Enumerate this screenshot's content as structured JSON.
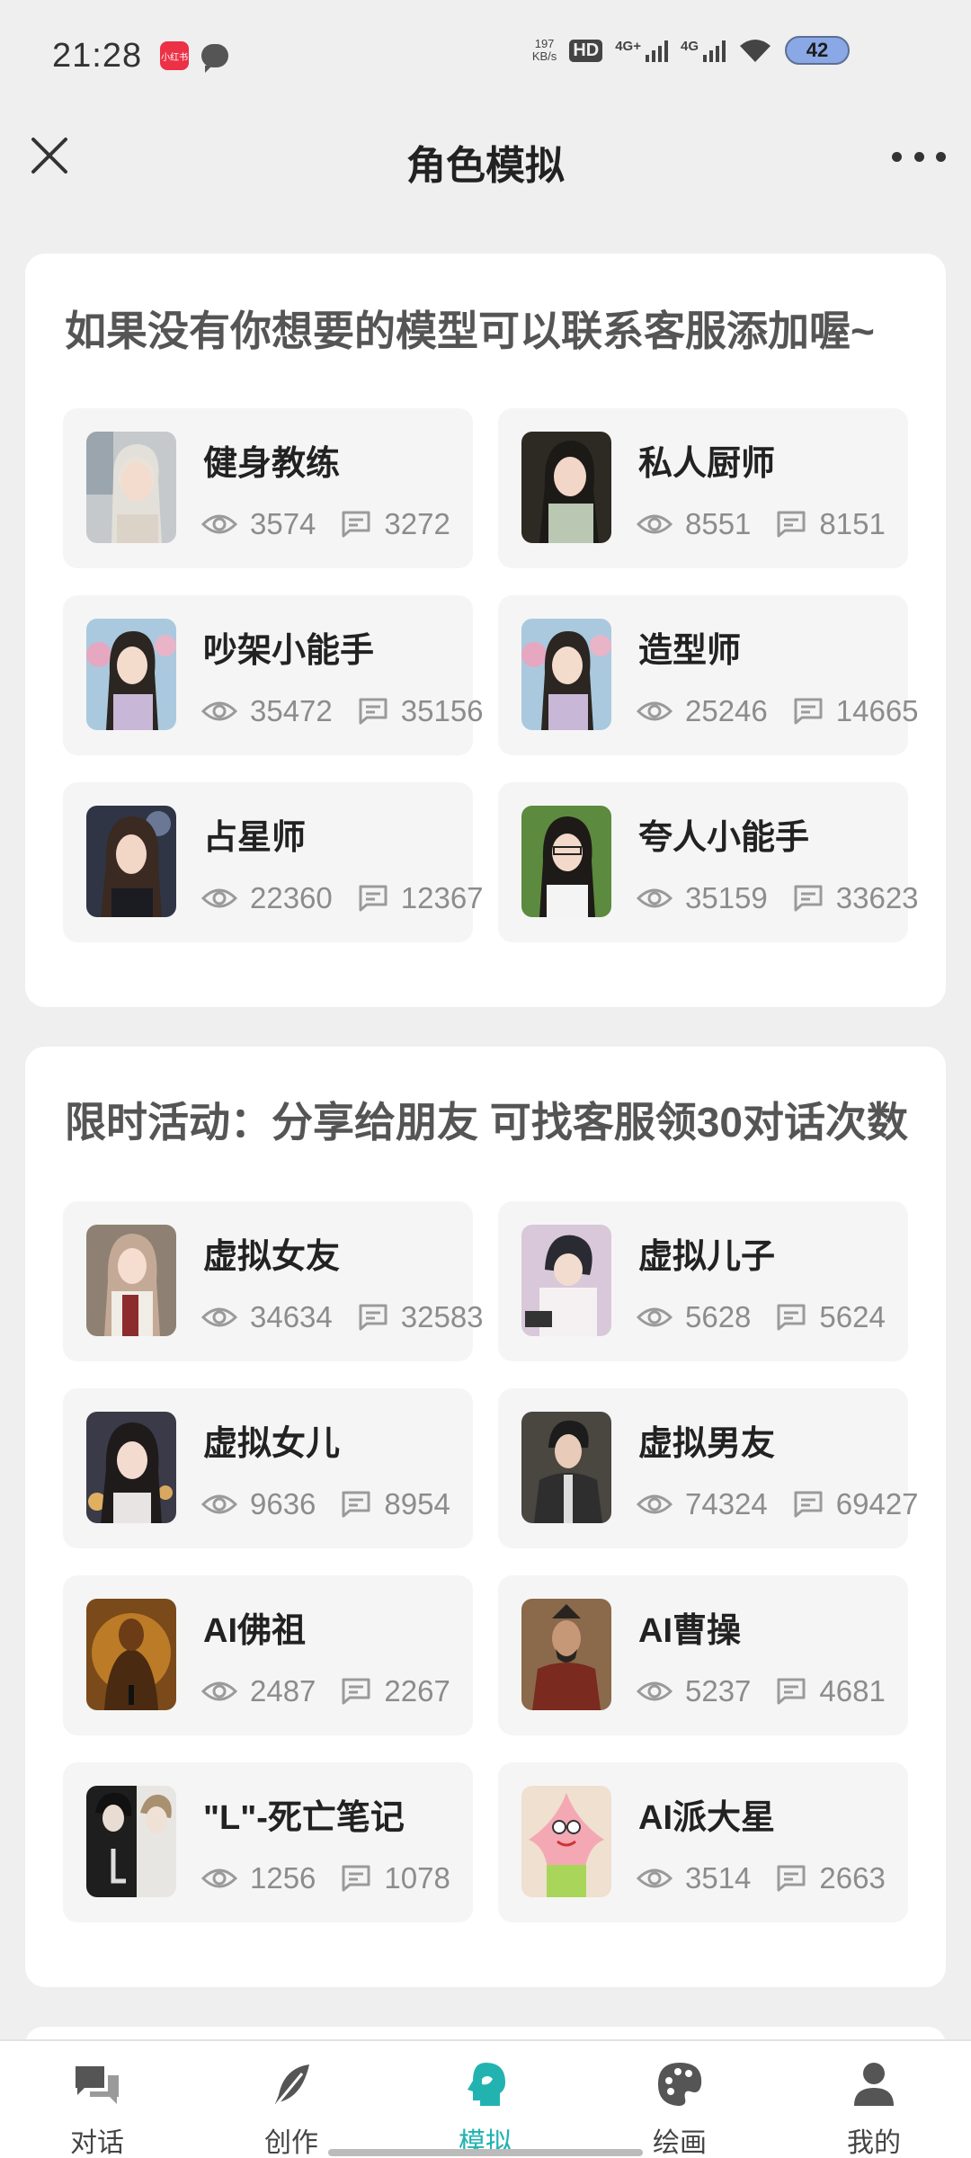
{
  "status": {
    "time": "21:28",
    "app_badge": "小红书",
    "net_speed_value": "197",
    "net_speed_unit": "KB/s",
    "hd": "HD",
    "signal1": "4G+",
    "signal2": "4G",
    "battery": "42"
  },
  "header": {
    "title": "角色模拟"
  },
  "section1": {
    "title": "如果没有你想要的模型可以联系客服添加喔~",
    "items": [
      {
        "name": "健身教练",
        "views": "3574",
        "comments": "3272"
      },
      {
        "name": "私人厨师",
        "views": "8551",
        "comments": "8151"
      },
      {
        "name": "吵架小能手",
        "views": "35472",
        "comments": "35156"
      },
      {
        "name": "造型师",
        "views": "25246",
        "comments": "14665"
      },
      {
        "name": "占星师",
        "views": "22360",
        "comments": "12367"
      },
      {
        "name": "夸人小能手",
        "views": "35159",
        "comments": "33623"
      }
    ]
  },
  "section2": {
    "title": "限时活动：分享给朋友 可找客服领30对话次数",
    "items": [
      {
        "name": "虚拟女友",
        "views": "34634",
        "comments": "32583"
      },
      {
        "name": "虚拟儿子",
        "views": "5628",
        "comments": "5624"
      },
      {
        "name": "虚拟女儿",
        "views": "9636",
        "comments": "8954"
      },
      {
        "name": "虚拟男友",
        "views": "74324",
        "comments": "69427"
      },
      {
        "name": "AI佛祖",
        "views": "2487",
        "comments": "2267"
      },
      {
        "name": "AI曹操",
        "views": "5237",
        "comments": "4681"
      },
      {
        "name": "\"L\"-死亡笔记",
        "views": "1256",
        "comments": "1078"
      },
      {
        "name": "AI派大星",
        "views": "3514",
        "comments": "2663"
      }
    ]
  },
  "nav": {
    "items": [
      {
        "label": "对话",
        "icon": "chat-icon"
      },
      {
        "label": "创作",
        "icon": "feather-icon"
      },
      {
        "label": "模拟",
        "icon": "head-icon"
      },
      {
        "label": "绘画",
        "icon": "palette-icon"
      },
      {
        "label": "我的",
        "icon": "user-icon"
      }
    ],
    "active_index": 2,
    "active_color": "#22b3b1"
  }
}
